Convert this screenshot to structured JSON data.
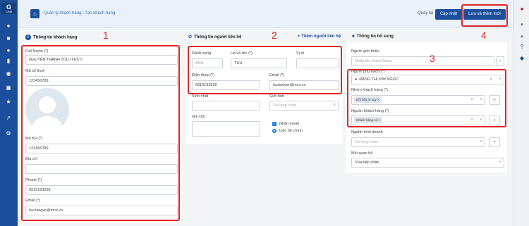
{
  "sidebar": {
    "logo_text": "CRM"
  },
  "topbar": {
    "breadcrumb": "Quản lý khách hàng \\ Tạo khách hàng",
    "back_label": "Quay lại",
    "update_label": "Cập nhật",
    "save_add_label": "Lưu và thêm mới"
  },
  "customer": {
    "title": "Thông tin khách hàng",
    "full_name_label": "Full Name (*)",
    "full_name_value": "NGUYỄN THÀNH TÚU (TEST)",
    "tax_label": "Mã số thuế",
    "tax_value": "123456789",
    "code_label": "Mã KH (*)",
    "code_value": "123456789",
    "address_label": "Địa chỉ",
    "address_value": "",
    "phone_label": "Phone (*)",
    "phone_value": "0919193939",
    "email_label": "Email (*)",
    "email_value": "tuu.lawyer@mcs.vn"
  },
  "contact": {
    "title": "Thông tin người liên hệ",
    "add_label": "+ Thêm người liên hệ",
    "salutation_label": "Danh xưng",
    "salutation_value": "ANH",
    "name_label": "Họ và tên (*)",
    "name_value": "TUU",
    "position_label": "Vị trí",
    "position_value": "",
    "phone_label": "Điện thoại (*)",
    "phone_value": "0919193939",
    "email_label": "Email (*)",
    "email_value": "tuulawyer@mcs.vn",
    "dob_label": "Sinh nhật",
    "gender_label": "Giới tính",
    "gender_placeholder": "Vui lòng chọn",
    "note_label": "Ghi chú",
    "receive_email_label": "Nhận email",
    "main_contact_label": "Liên hệ chính"
  },
  "additional": {
    "title": "Thông tin bổ sung",
    "referrer_label": "Người giới thiệu",
    "referrer_placeholder": "Nhập tên khách hàng",
    "owner_label": "Người phụ trách (*)",
    "owner_value": "ĐẶNG THỊ KIM NGỌC",
    "group_label": "Nhóm khách hàng (*)",
    "group_tag": "Đối tiểu trì suy",
    "source_label": "Nguồn khách hàng (*)",
    "source_tag": "Khách hàng cũ",
    "industry_label": "Ngành kinh doanh",
    "industry_placeholder": "Vui lòng chọn",
    "relation_label": "Mối quan hệ",
    "relation_value": "Vừa tiếp nhận"
  },
  "annotations": {
    "n1": "1",
    "n2": "2",
    "n3": "3",
    "n4": "4"
  }
}
